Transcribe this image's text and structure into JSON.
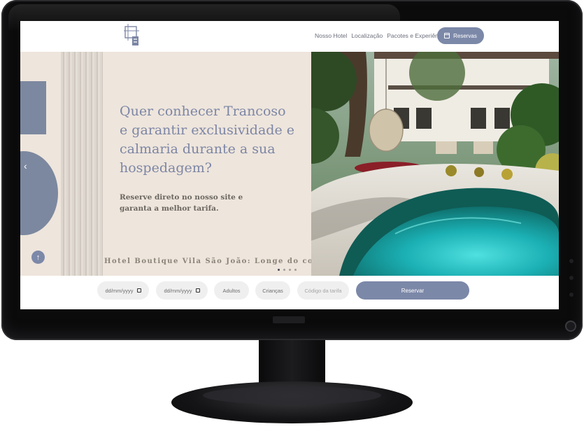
{
  "header": {
    "nav": [
      "Nosso Hotel",
      "Localização",
      "Pacotes e Experiências"
    ],
    "reserve_label": "Reservas"
  },
  "hero": {
    "title": "Quer conhecer Trancoso e garantir exclusividade e calmaria durante a sua hospedagem?",
    "subtitle": "Reserve direto no nosso site e garanta a melhor tarifa.",
    "tagline": "Hotel Boutique Vila São João: Longe do comum",
    "prev_glyph": "‹",
    "scroll_top_glyph": "↑"
  },
  "booking": {
    "checkin_value": "dd/mm/yyyy",
    "checkout_value": "dd/mm/yyyy",
    "adults_label": "Adultos",
    "children_label": "Crianças",
    "promo_placeholder": "Código da tarifa",
    "submit_label": "Reservar"
  },
  "colors": {
    "accent": "#7c88a8",
    "hero_bg": "#eee5dc",
    "title": "#7c86a5"
  },
  "icons": {
    "logo": "hotel-logo-icon",
    "calendar": "calendar-icon",
    "scroll_top": "arrow-up-icon"
  }
}
